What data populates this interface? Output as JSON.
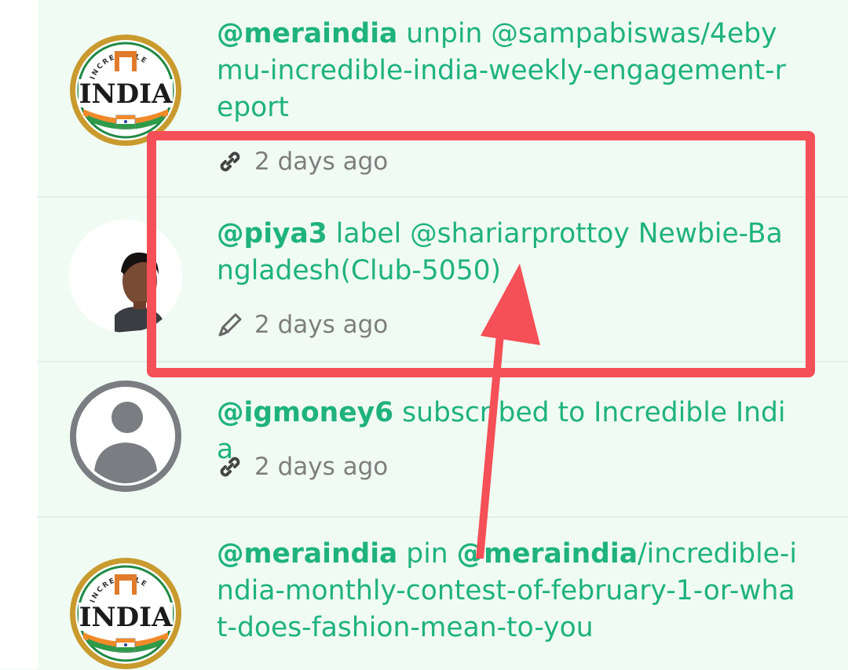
{
  "feed": [
    {
      "user": "@meraindia",
      "action": " unpin ",
      "target": "@sampabiswas/4ebymu-incredible-india-weekly-engagement-report",
      "time": "2 days ago",
      "icon": "link-icon",
      "avatar": "incredible-india-logo"
    },
    {
      "user": "@piya3",
      "action": " label @shariarprottoy Newbie-Bangladesh(Club-5050)",
      "time": "2 days ago",
      "icon": "pencil-icon",
      "avatar": "user-photo"
    },
    {
      "user": "@igmoney6",
      "action": " subscribed to Incredible India",
      "time": "2 days ago",
      "icon": "link-icon",
      "avatar": "default-user-avatar"
    },
    {
      "user": "@meraindia",
      "action": " pin ",
      "target_user": "@meraindia",
      "target_path": "/incredible-india-monthly-contest-of-february-1-or-what-does-fashion-mean-to-you",
      "avatar": "incredible-india-logo"
    }
  ],
  "logo": {
    "arc_text": "INCREDIBLE",
    "word": "INDIA"
  },
  "colors": {
    "accent": "#1fb27f",
    "muted": "#7e7e7e",
    "background": "#f0fcf3",
    "annotation": "#f54f57"
  }
}
